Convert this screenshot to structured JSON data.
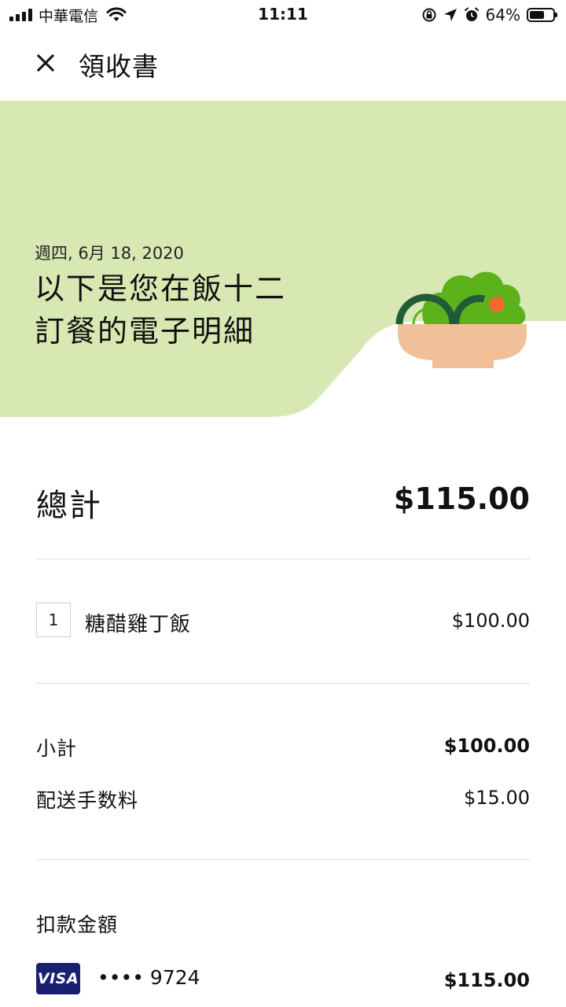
{
  "status_bar": {
    "carrier": "中華電信",
    "time": "11:11",
    "battery_percent": "64%",
    "battery_level": 0.64
  },
  "header": {
    "title": "領收書",
    "close_icon": "close-icon"
  },
  "hero": {
    "date": "週四, 6月 18, 2020",
    "title_line1": "以下是您在飯十二",
    "title_line2": "訂餐的電子明細",
    "background_color": "#d8e8b2",
    "illustration": "salad-bowl-icon"
  },
  "total": {
    "label": "總計",
    "value": "$115.00"
  },
  "items": [
    {
      "qty": "1",
      "name": "糖醋雞丁飯",
      "price": "$100.00"
    }
  ],
  "summary": {
    "subtotal_label": "小計",
    "subtotal_value": "$100.00",
    "delivery_label": "配送手数料",
    "delivery_value": "$15.00"
  },
  "payment": {
    "label": "扣款金額",
    "card_brand": "VISA",
    "card_mask": "•••• 9724",
    "amount": "$115.00",
    "brand_color": "#1a1f71"
  }
}
